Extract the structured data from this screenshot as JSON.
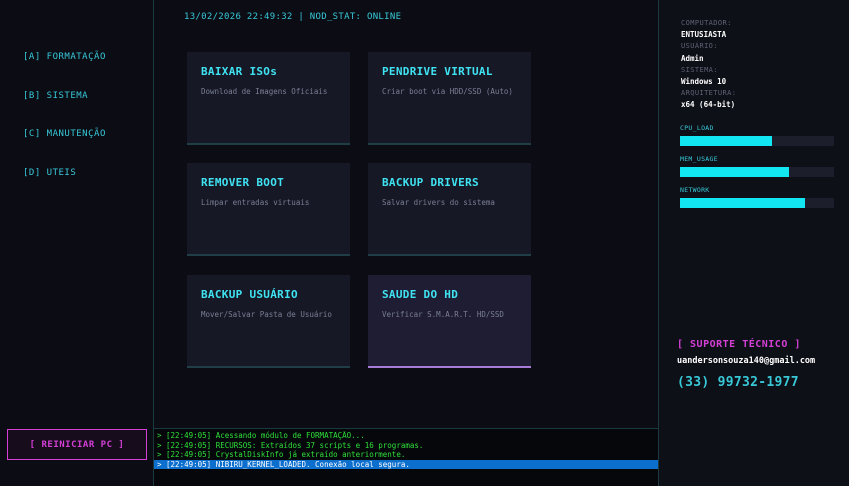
{
  "header": {
    "status": "13/02/2026 22:49:32 | NOD_STAT: ONLINE"
  },
  "sidebar": {
    "items": [
      {
        "label": "[A] FORMATAÇÃO"
      },
      {
        "label": "[B] SISTEMA"
      },
      {
        "label": "[C] MANUTENÇÃO"
      },
      {
        "label": "[D] UTEIS"
      }
    ],
    "reboot_label": "[ REINICIAR PC ]"
  },
  "cards": [
    {
      "title": "BAIXAR ISOs",
      "desc": "Download de Imagens Oficiais"
    },
    {
      "title": "PENDRIVE VIRTUAL",
      "desc": "Criar boot via HDD/SSD (Auto)"
    },
    {
      "title": "REMOVER BOOT",
      "desc": "Limpar entradas virtuais"
    },
    {
      "title": "BACKUP DRIVERS",
      "desc": "Salvar drivers do sistema"
    },
    {
      "title": "BACKUP USUÁRIO",
      "desc": "Mover/Salvar Pasta de Usuário"
    },
    {
      "title": "SAUDE DO HD",
      "desc": "Verificar S.M.A.R.T. HD/SSD"
    }
  ],
  "system_info": {
    "computer_label": "COMPUTADOR:",
    "computer": "ENTUSIASTA",
    "user_label": "USUÁRIO:",
    "user": "Admin",
    "os_label": "SISTEMA:",
    "os": "Windows 10",
    "arch_label": "ARQUITETURA:",
    "arch": "x64 (64-bit)"
  },
  "meters": [
    {
      "label": "CPU_LOAD",
      "value": 0.6
    },
    {
      "label": "MEM_USAGE",
      "value": 0.71
    },
    {
      "label": "NETWORK",
      "value": 0.81
    }
  ],
  "support": {
    "title": "[ SUPORTE TÉCNICO ]",
    "email": "uandersonsouza140@gmail.com",
    "phone": "(33) 99732-1977"
  },
  "console": {
    "lines": [
      "> [22:49:05] Acessando módulo de FORMATAÇÃO...",
      "> [22:49:05] RECURSOS: Extraídos 37 scripts e 16 programas.",
      "> [22:49:05] CrystalDiskInfo já extraído anteriormente.",
      "> [22:49:05] NIBIRU_KERNEL_LOADED. Conexão local segura."
    ]
  },
  "colors": {
    "accent": "#38c9d8",
    "magenta": "#d43fd6",
    "log": "#2fe03a",
    "selection": "#0c6fce"
  }
}
